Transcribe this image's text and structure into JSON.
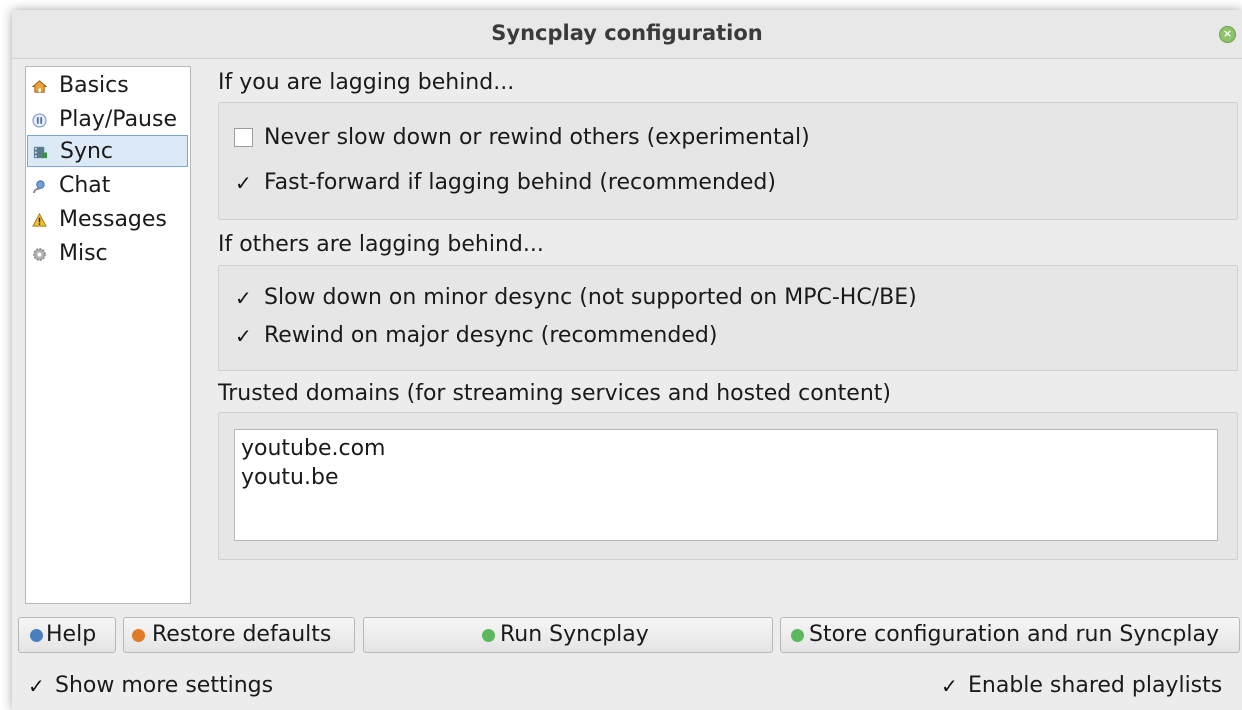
{
  "window": {
    "title": "Syncplay configuration",
    "close_icon": "close-icon"
  },
  "sidebar": {
    "selected": "Sync",
    "items": [
      {
        "label": "Basics",
        "icon": "house-icon"
      },
      {
        "label": "Play/Pause",
        "icon": "pause-icon"
      },
      {
        "label": "Sync",
        "icon": "film-strip-icon"
      },
      {
        "label": "Chat",
        "icon": "chat-icon"
      },
      {
        "label": "Messages",
        "icon": "warning-icon"
      },
      {
        "label": "Misc",
        "icon": "gear-icon"
      }
    ]
  },
  "main": {
    "lagging_self": {
      "label": "If you are lagging behind...",
      "options": [
        {
          "label": "Never slow down or rewind others (experimental)",
          "checked": false
        },
        {
          "label": "Fast-forward if lagging behind (recommended)",
          "checked": true
        }
      ]
    },
    "lagging_others": {
      "label": "If others are lagging behind...",
      "options": [
        {
          "label": "Slow down on minor desync (not supported on MPC-HC/BE)",
          "checked": true
        },
        {
          "label": "Rewind on major desync (recommended)",
          "checked": true
        }
      ]
    },
    "trusted_domains": {
      "label": "Trusted domains (for streaming services and hosted content)",
      "lines": [
        "youtube.com",
        "youtu.be"
      ]
    }
  },
  "footer": {
    "help_label": "Help",
    "restore_label": "Restore defaults",
    "run_label": "Run Syncplay",
    "store_run_label": "Store configuration and run Syncplay",
    "show_more_label": "Show more settings",
    "show_more_checked": true,
    "shared_playlists_label": "Enable shared playlists",
    "shared_playlists_checked": true
  },
  "colors": {
    "accent_selection": "#dce9f7",
    "run_icon_green": "#5cb85c",
    "help_icon_blue": "#4a7fc1",
    "restore_icon_orange": "#e07b27"
  }
}
